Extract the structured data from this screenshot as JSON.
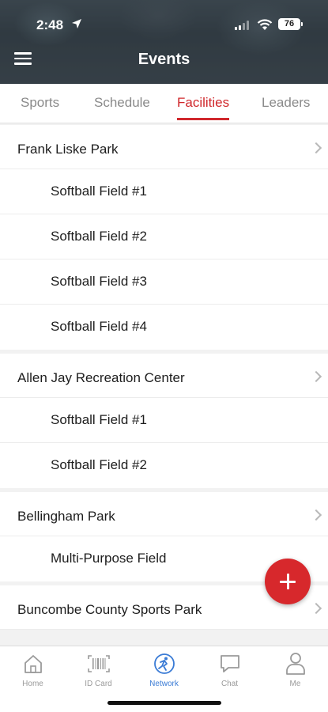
{
  "status_bar": {
    "time": "2:48",
    "battery": "76"
  },
  "header": {
    "title": "Events"
  },
  "tabs": [
    {
      "label": "Sports",
      "active": false
    },
    {
      "label": "Schedule",
      "active": false
    },
    {
      "label": "Facilities",
      "active": true
    },
    {
      "label": "Leaders",
      "active": false
    }
  ],
  "facilities": [
    {
      "name": "Frank Liske Park",
      "fields": [
        "Softball Field #1",
        "Softball Field #2",
        "Softball Field #3",
        "Softball Field #4"
      ]
    },
    {
      "name": "Allen Jay Recreation Center",
      "fields": [
        "Softball Field #1",
        "Softball Field #2"
      ]
    },
    {
      "name": "Bellingham Park",
      "fields": [
        "Multi-Purpose Field"
      ]
    },
    {
      "name": "Buncombe County Sports Park",
      "fields": []
    }
  ],
  "bottom_nav": [
    {
      "label": "Home",
      "icon": "home-icon",
      "active": false
    },
    {
      "label": "ID Card",
      "icon": "barcode-icon",
      "active": false
    },
    {
      "label": "Network",
      "icon": "network-icon",
      "active": true
    },
    {
      "label": "Chat",
      "icon": "chat-icon",
      "active": false
    },
    {
      "label": "Me",
      "icon": "person-icon",
      "active": false
    }
  ],
  "colors": {
    "accent": "#d0282c",
    "nav_active": "#3a7bd5"
  }
}
